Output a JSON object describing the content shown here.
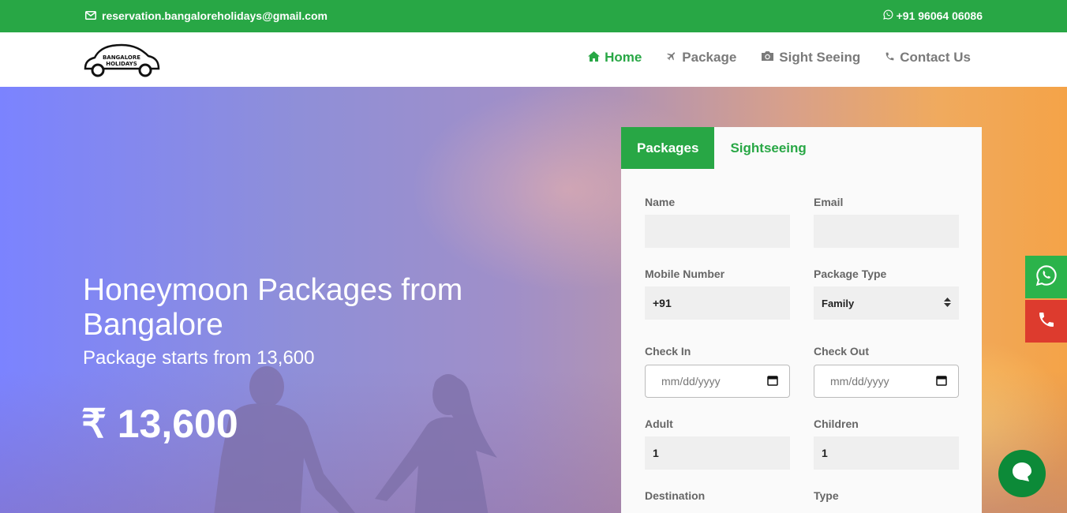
{
  "topbar": {
    "email": "reservation.bangaloreholidays@gmail.com",
    "phone": "+91 96064 06086",
    "email_icon": "envelope-icon",
    "phone_icon": "whatsapp-icon"
  },
  "header": {
    "logo_text_1": "BANGALORE",
    "logo_text_2": "HOLIDAYS",
    "nav": [
      {
        "label": "Home",
        "icon": "home-icon"
      },
      {
        "label": "Package",
        "icon": "plane-icon"
      },
      {
        "label": "Sight Seeing",
        "icon": "camera-icon"
      },
      {
        "label": "Contact Us",
        "icon": "phone-icon"
      }
    ]
  },
  "hero": {
    "title": "Honeymoon Packages from Bangalore",
    "subtitle": "Package starts from 13,600",
    "price": "₹ 13,600"
  },
  "form": {
    "tabs": [
      "Packages",
      "Sightseeing"
    ],
    "active_tab": "Packages",
    "name_label": "Name",
    "name_value": "",
    "email_label": "Email",
    "email_value": "",
    "mobile_label": "Mobile Number",
    "mobile_value": "+91",
    "package_type_label": "Package Type",
    "package_type_value": "Family",
    "check_in_label": "Check In",
    "check_in_placeholder": "mm/dd/yyyy",
    "check_out_label": "Check Out",
    "check_out_placeholder": "mm/dd/yyyy",
    "adult_label": "Adult",
    "adult_value": "1",
    "children_label": "Children",
    "children_value": "1",
    "destination_label": "Destination",
    "type_label": "Type"
  },
  "colors": {
    "brand_green": "#28a745",
    "call_red": "#dd3b2e",
    "chat_green": "#0c8a38"
  }
}
